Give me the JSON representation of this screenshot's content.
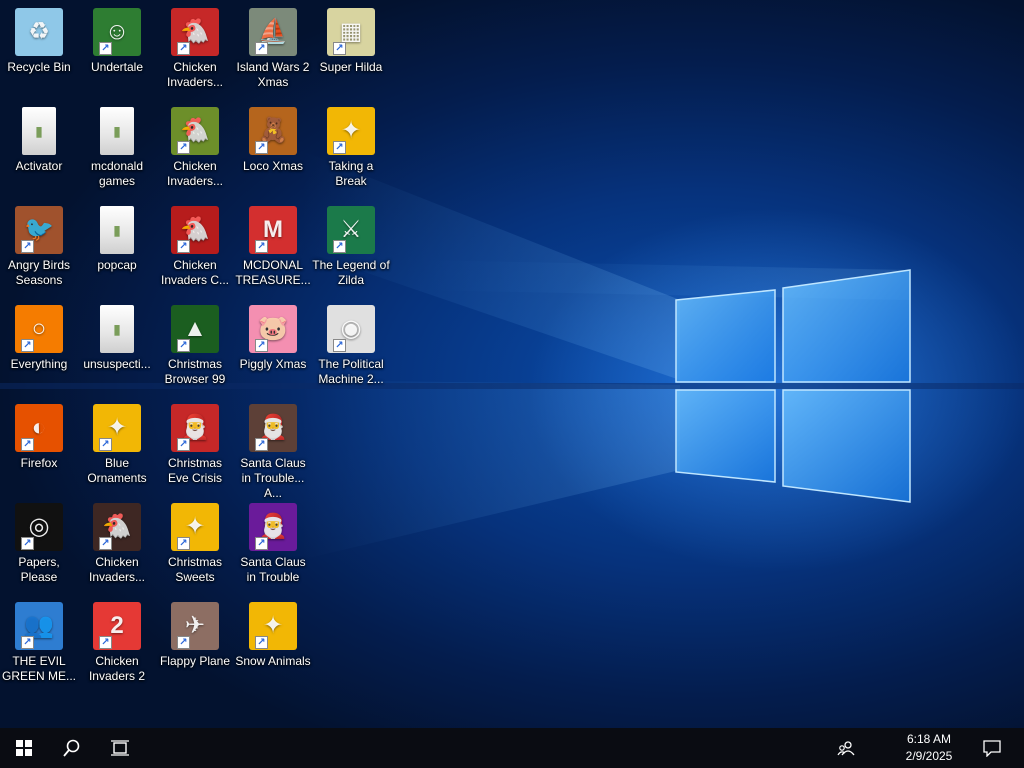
{
  "desktop": {
    "icons": [
      {
        "label": "Recycle Bin",
        "icon": "recycle-bin-icon",
        "bg": "#8fc8e8",
        "glyph": "♻",
        "shortcut": false
      },
      {
        "label": "Undertale",
        "icon": "undertale-icon",
        "bg": "#2e7d32",
        "glyph": "☺",
        "shortcut": true
      },
      {
        "label": "Chicken Invaders...",
        "icon": "chicken-invaders-icon",
        "bg": "#c62828",
        "glyph": "🐔",
        "shortcut": true
      },
      {
        "label": "Island Wars 2 Xmas",
        "icon": "island-wars-icon",
        "bg": "#7c8a7a",
        "glyph": "⛵",
        "shortcut": true
      },
      {
        "label": "Super Hilda",
        "icon": "super-hilda-icon",
        "bg": "#d8d4a0",
        "glyph": "▦",
        "shortcut": true
      },
      {
        "label": "Activator",
        "icon": "folder-icon",
        "bg": "#ececec",
        "glyph": "▮",
        "shortcut": false,
        "folder": true
      },
      {
        "label": "mcdonald games",
        "icon": "folder-icon",
        "bg": "#ececec",
        "glyph": "▮",
        "shortcut": false,
        "folder": true
      },
      {
        "label": "Chicken Invaders...",
        "icon": "chicken-invaders-icon",
        "bg": "#6d8f2a",
        "glyph": "🐔",
        "shortcut": true
      },
      {
        "label": "Loco Xmas",
        "icon": "loco-xmas-icon",
        "bg": "#b5651d",
        "glyph": "🧸",
        "shortcut": true
      },
      {
        "label": "Taking a Break",
        "icon": "puzzle-game-icon",
        "bg": "#f2b705",
        "glyph": "✦",
        "shortcut": true
      },
      {
        "label": "Angry Birds Seasons",
        "icon": "angry-birds-icon",
        "bg": "#a0522d",
        "glyph": "🐦",
        "shortcut": true
      },
      {
        "label": "popcap",
        "icon": "folder-icon",
        "bg": "#ececec",
        "glyph": "▮",
        "shortcut": false,
        "folder": true
      },
      {
        "label": "Chicken Invaders C...",
        "icon": "chicken-invaders-icon",
        "bg": "#b71c1c",
        "glyph": "🐔",
        "shortcut": true
      },
      {
        "label": "MCDONAL TREASURE...",
        "icon": "mcdonalds-icon",
        "bg": "#d32f2f",
        "glyph": "M",
        "shortcut": true
      },
      {
        "label": "The Legend of Zilda",
        "icon": "legend-zilda-icon",
        "bg": "#1b7a4a",
        "glyph": "⚔",
        "shortcut": true
      },
      {
        "label": "Everything",
        "icon": "search-magnifier-icon",
        "bg": "#f57c00",
        "glyph": "○",
        "shortcut": true
      },
      {
        "label": "unsuspecti...",
        "icon": "folder-icon",
        "bg": "#ececec",
        "glyph": "▮",
        "shortcut": false,
        "folder": true
      },
      {
        "label": "Christmas Browser 99",
        "icon": "christmas-tree-icon",
        "bg": "#1b5e20",
        "glyph": "▲",
        "shortcut": true
      },
      {
        "label": "Piggly Xmas",
        "icon": "piggly-xmas-icon",
        "bg": "#f48fb1",
        "glyph": "🐷",
        "shortcut": true
      },
      {
        "label": "The Political Machine 2...",
        "icon": "political-machine-icon",
        "bg": "#e0e0e0",
        "glyph": "◉",
        "shortcut": true
      },
      {
        "label": "Firefox",
        "icon": "firefox-icon",
        "bg": "#e65100",
        "glyph": "◐",
        "shortcut": true
      },
      {
        "label": "Blue Ornaments",
        "icon": "puzzle-game-icon",
        "bg": "#f2b705",
        "glyph": "✦",
        "shortcut": true
      },
      {
        "label": "Christmas Eve Crisis",
        "icon": "santa-icon",
        "bg": "#c62828",
        "glyph": "🎅",
        "shortcut": true
      },
      {
        "label": "Santa Claus in Trouble... A...",
        "icon": "santa-icon",
        "bg": "#5d4037",
        "glyph": "🎅",
        "shortcut": true
      },
      {
        "label": "Papers, Please",
        "icon": "papers-please-icon",
        "bg": "#111111",
        "glyph": "◎",
        "shortcut": true
      },
      {
        "label": "Chicken Invaders...",
        "icon": "chicken-invaders-icon",
        "bg": "#3e2723",
        "glyph": "🐔",
        "shortcut": true
      },
      {
        "label": "Christmas Sweets",
        "icon": "puzzle-game-icon",
        "bg": "#f2b705",
        "glyph": "✦",
        "shortcut": true
      },
      {
        "label": "Santa Claus in Trouble",
        "icon": "santa-icon",
        "bg": "#6a1b9a",
        "glyph": "🎅",
        "shortcut": true
      },
      {
        "label": "THE EVIL GREEN ME...",
        "icon": "messenger-icon",
        "bg": "#2e7dd1",
        "glyph": "👥",
        "shortcut": true
      },
      {
        "label": "Chicken Invaders 2",
        "icon": "chicken-invaders-icon",
        "bg": "#e53935",
        "glyph": "2",
        "shortcut": true
      },
      {
        "label": "Flappy Plane",
        "icon": "flappy-plane-icon",
        "bg": "#8d6e63",
        "glyph": "✈",
        "shortcut": true
      },
      {
        "label": "Snow Animals",
        "icon": "puzzle-game-icon",
        "bg": "#f2b705",
        "glyph": "✦",
        "shortcut": true
      }
    ]
  },
  "taskbar": {
    "time": "6:18 AM",
    "date": "2/9/2025",
    "icons": {
      "start": "windows-start-icon",
      "search": "search-icon",
      "task_view": "task-view-icon",
      "people": "people-icon",
      "notifications": "action-center-icon"
    }
  },
  "colors": {
    "taskbar": "#0a0c12",
    "wallpaper_accent": "#1f8dff",
    "label_text": "#ffffff"
  }
}
